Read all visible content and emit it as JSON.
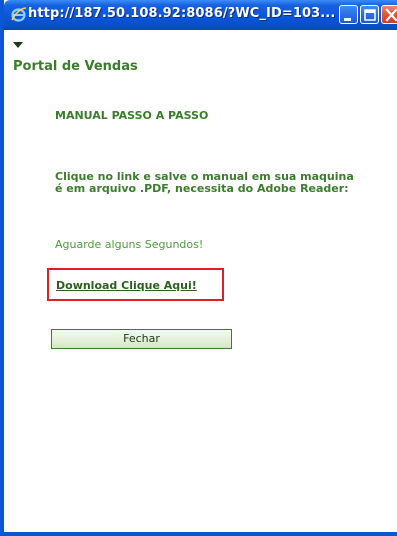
{
  "window": {
    "title": "http://187.50.108.92:8086/?WC_ID=103...",
    "icon": "internet-explorer-icon",
    "controls": [
      "minimize-icon",
      "maximize-icon",
      "close-icon"
    ],
    "accent_color": "#0a57d6"
  },
  "page": {
    "portal_title": "Portal de Vendas",
    "manual_title": "MANUAL PASSO A PASSO",
    "instructions": "Clique no link e salve o manual em sua maquina é em arquivo .PDF, necessita do Adobe Reader:",
    "wait_text": "Aguarde alguns Segundos!",
    "download_link": "Download Clique Aqui!",
    "close_button": "Fechar",
    "text_color": "#3a7d2b",
    "highlight_color": "#e02020"
  }
}
